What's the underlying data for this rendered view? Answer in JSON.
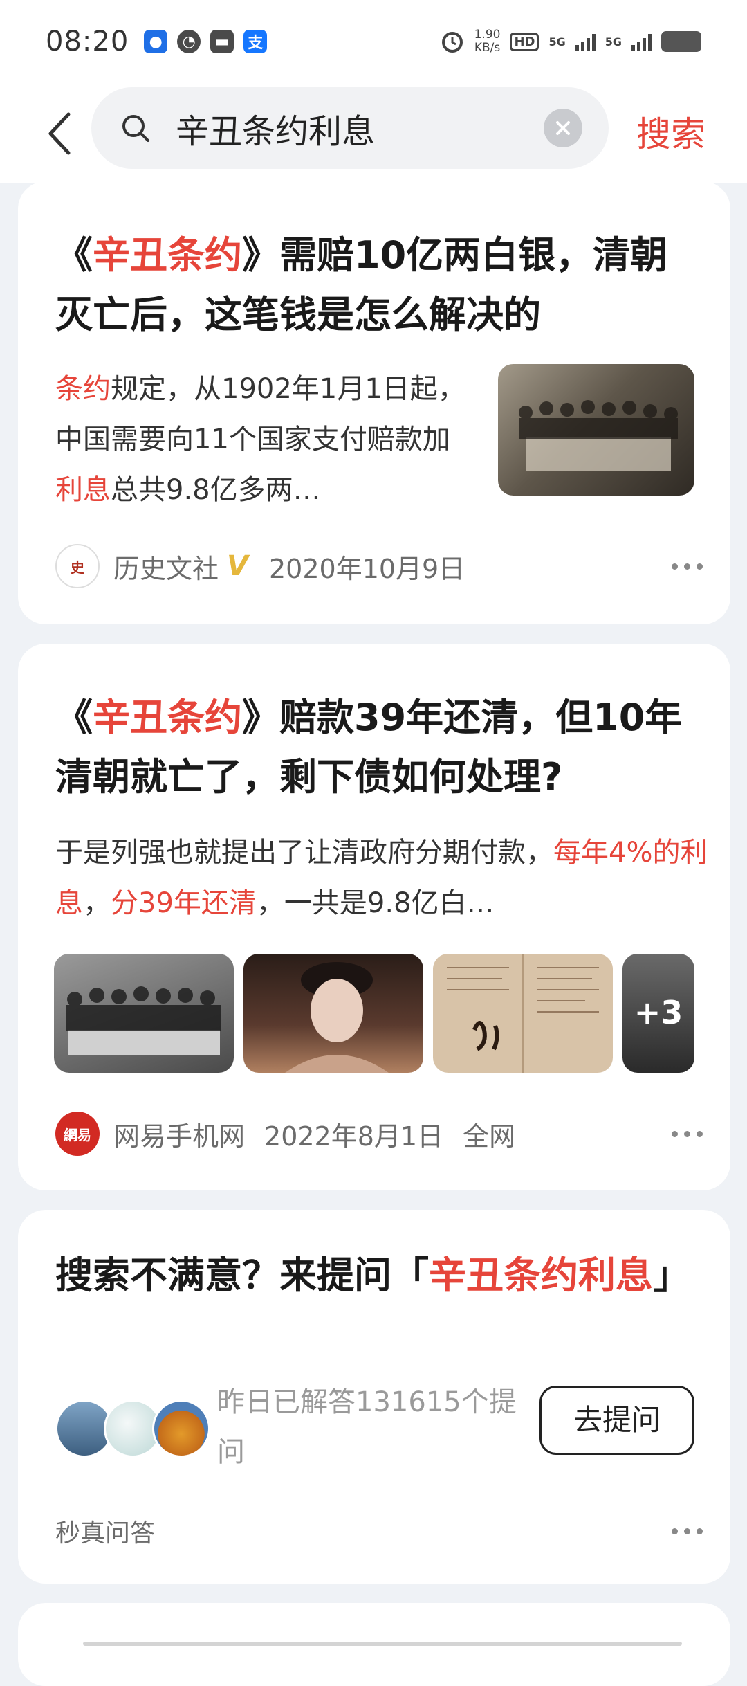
{
  "status_bar": {
    "time": "08:20",
    "net_speed_value": "1.90",
    "net_speed_unit": "KB/s",
    "hd_label": "HD",
    "signal1": "5G",
    "signal2": "5G",
    "app_icons": [
      "location-app-icon",
      "speed-app-icon",
      "message-app-icon",
      "alipay-icon"
    ]
  },
  "search": {
    "query": "辛丑条约利息",
    "button_label": "搜索"
  },
  "results": [
    {
      "title_parts": [
        "《",
        "辛丑条约",
        "》需赔10亿两白银，清朝灭亡后，这笔钱是怎么解决的"
      ],
      "snippet_parts": [
        "条约",
        "规定，从1902年1月1日起，中国需要向11个国家支付赔款加",
        "利息",
        "总共9.8亿多两…"
      ],
      "source": "历史文社",
      "verified_mark": "V",
      "date": "2020年10月9日"
    },
    {
      "title_parts": [
        "《",
        "辛丑条约",
        "》赔款39年还清，但10年清朝就亡了，剩下债如何处理?"
      ],
      "snippet_parts": [
        "于是列强也就提出了让清政府分期付款，",
        "每年4%的利息",
        "，",
        "分39年还清",
        "，一共是9.8亿白…"
      ],
      "more_images": "+3",
      "source": "网易手机网",
      "source_logo_text": "網易",
      "date": "2022年8月1日",
      "scope": "全网"
    }
  ],
  "ask_card": {
    "title_prefix": "搜索不满意？来提问「",
    "title_highlight": "辛丑条约利息",
    "title_suffix": "」",
    "answered_text": "昨日已解答131615个提问",
    "ask_button": "去提问",
    "footer_source": "秒真问答"
  },
  "colors": {
    "accent": "#e6453a",
    "background": "#eff2f6"
  }
}
